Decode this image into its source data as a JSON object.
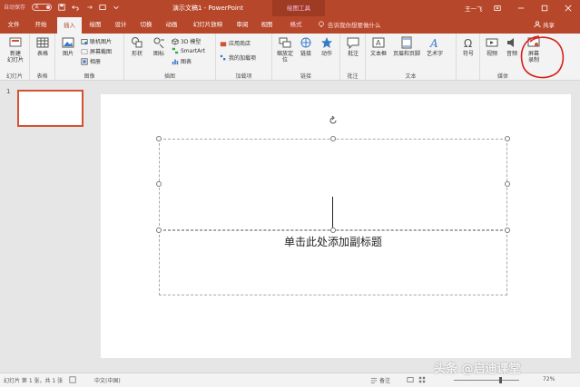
{
  "colors": {
    "accent": "#b7472a",
    "annotation": "#d6201c"
  },
  "qat": {
    "autosave": "自动保存",
    "toggle": "关"
  },
  "title": {
    "document": "演示文稿1 - PowerPoint",
    "context_tools": "绘图工具",
    "user": "王一飞"
  },
  "tabs": [
    "文件",
    "开始",
    "插入",
    "绘图",
    "设计",
    "切换",
    "动画",
    "幻灯片放映",
    "审阅",
    "视图",
    "格式"
  ],
  "tellme": "告诉我你想要做什么",
  "share": "共享",
  "ribbon": {
    "slides": {
      "new_slide": "新建",
      "new_slide2": "幻灯片",
      "label": "幻灯片"
    },
    "tables": {
      "table": "表格",
      "label": "表格"
    },
    "images": {
      "pictures": "图片",
      "online": "联机图片",
      "screenshot": "屏幕截图",
      "album": "相册",
      "label": "图像"
    },
    "illustrations": {
      "shapes": "形状",
      "icons": "图标",
      "models": "3D 模型",
      "smartart": "SmartArt",
      "chart": "图表",
      "label": "插图"
    },
    "addins": {
      "store": "应用商店",
      "my_addins": "我的加载项",
      "label": "加载项"
    },
    "zoom": {
      "zoom": "缩放定",
      "zoom2": "位",
      "label": "链接"
    },
    "links": {
      "link": "链接",
      "action": "动作"
    },
    "comments": {
      "comment": "批注",
      "label": "批注"
    },
    "text": {
      "textbox": "文本框",
      "header": "页眉和页脚",
      "wordart": "艺术字",
      "label": "文本"
    },
    "symbols": {
      "symbol": "符号"
    },
    "media": {
      "video": "视频",
      "audio": "音频",
      "screenrec": "屏幕",
      "screenrec2": "录制",
      "label": "媒体"
    }
  },
  "slide_panel": {
    "number": "1"
  },
  "slide": {
    "subtitle_placeholder": "单击此处添加副标题"
  },
  "status": {
    "slide_info": "幻灯片 第 1 张，共 1 张",
    "language": "中文(中国)",
    "notes": "备注",
    "zoom": "72%"
  },
  "watermark": "头条 @启迪课堂"
}
